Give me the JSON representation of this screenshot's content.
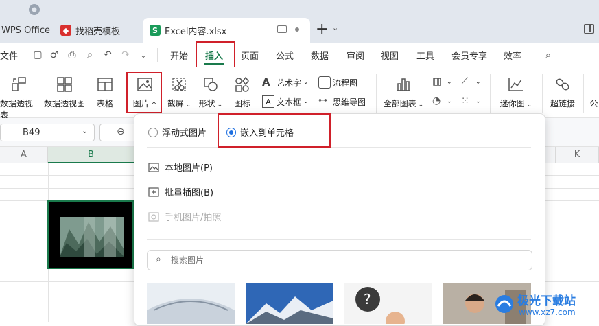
{
  "titlebar": {
    "tabs": [
      {
        "label": "WPS Office"
      },
      {
        "label": "找稻壳模板"
      },
      {
        "label": "Excel内容.xlsx",
        "icon": "S"
      }
    ],
    "new_tab": "+"
  },
  "menu": {
    "file": "文件",
    "items": [
      "开始",
      "插入",
      "页面",
      "公式",
      "数据",
      "审阅",
      "视图",
      "工具",
      "会员专享",
      "效率"
    ],
    "active": "插入"
  },
  "ribbon": {
    "pivot_table": "数据透视表",
    "pivot_chart": "数据透视图",
    "table": "表格",
    "picture": "图片",
    "screenshot": "截屏",
    "shapes": "形状",
    "icons": "图标",
    "wordart": "艺术字",
    "textbox": "文本框",
    "flowchart": "流程图",
    "mindmap": "思维导图",
    "all_charts": "全部图表",
    "sparkline": "迷你图",
    "hyperlink": "超链接",
    "more": "公"
  },
  "namebox": {
    "value": "B49"
  },
  "columns": [
    "A",
    "B",
    "K"
  ],
  "dropdown": {
    "float_picture": "浮动式图片",
    "embed_cell": "嵌入到单元格",
    "local_picture": "本地图片(P)",
    "batch_insert": "批量插图(B)",
    "phone_picture": "手机图片/拍照",
    "search_placeholder": "搜索图片"
  },
  "watermark": {
    "site": "极光下载站",
    "url": "www.xz7.com"
  },
  "colors": {
    "accent": "#1a7a4c",
    "highlight": "#d0202a",
    "radio": "#1e6fe0"
  }
}
